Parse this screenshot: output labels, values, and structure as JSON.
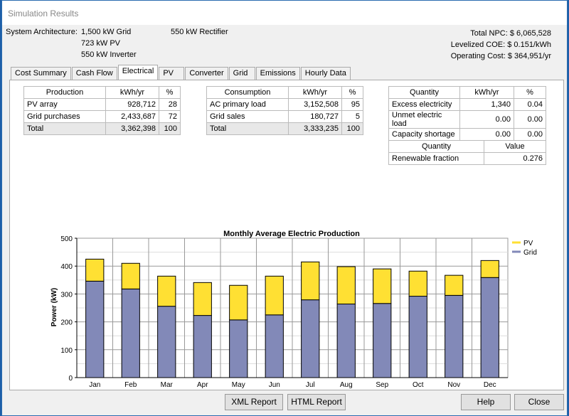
{
  "window": {
    "title": "Simulation Results"
  },
  "architecture": {
    "label": "System Architecture:",
    "items": [
      "1,500 kW Grid",
      "723 kW PV",
      "550 kW Inverter",
      "550 kW Rectifier"
    ]
  },
  "costs": [
    {
      "label": "Total NPC:",
      "value": "$ 6,065,528"
    },
    {
      "label": "Levelized COE:",
      "value": "$ 0.151/kWh"
    },
    {
      "label": "Operating Cost:",
      "value": "$ 364,951/yr"
    }
  ],
  "tabs": [
    "Cost Summary",
    "Cash Flow",
    "Electrical",
    "PV",
    "Converter",
    "Grid",
    "Emissions",
    "Hourly Data"
  ],
  "active_tab": "Electrical",
  "production": {
    "headers": [
      "Production",
      "kWh/yr",
      "%"
    ],
    "rows": [
      [
        "PV array",
        "928,712",
        "28"
      ],
      [
        "Grid purchases",
        "2,433,687",
        "72"
      ],
      [
        "Total",
        "3,362,398",
        "100"
      ]
    ]
  },
  "consumption": {
    "headers": [
      "Consumption",
      "kWh/yr",
      "%"
    ],
    "rows": [
      [
        "AC primary load",
        "3,152,508",
        "95"
      ],
      [
        "Grid sales",
        "180,727",
        "5"
      ],
      [
        "Total",
        "3,333,235",
        "100"
      ]
    ]
  },
  "quantity": {
    "headers": [
      "Quantity",
      "kWh/yr",
      "%"
    ],
    "rows": [
      [
        "Excess electricity",
        "1,340",
        "0.04"
      ],
      [
        "Unmet electric load",
        "0.00",
        "0.00"
      ],
      [
        "Capacity shortage",
        "0.00",
        "0.00"
      ]
    ]
  },
  "renewable": {
    "headers": [
      "Quantity",
      "Value"
    ],
    "rows": [
      [
        "Renewable fraction",
        "0.276"
      ]
    ]
  },
  "chart_data": {
    "type": "bar",
    "stacked": true,
    "title": "Monthly Average Electric Production",
    "xlabel": "",
    "ylabel": "Power (kW)",
    "ylim": [
      0,
      500
    ],
    "yticks": [
      0,
      100,
      200,
      300,
      400,
      500
    ],
    "grid": true,
    "legend": "top-right",
    "categories": [
      "Jan",
      "Feb",
      "Mar",
      "Apr",
      "May",
      "Jun",
      "Jul",
      "Aug",
      "Sep",
      "Oct",
      "Nov",
      "Dec"
    ],
    "series": [
      {
        "name": "Grid",
        "color": "#8289b8",
        "values": [
          346,
          318,
          256,
          223,
          207,
          225,
          279,
          264,
          266,
          292,
          295,
          359
        ]
      },
      {
        "name": "PV",
        "color": "#ffe033",
        "values": [
          79,
          92,
          108,
          118,
          124,
          139,
          136,
          134,
          124,
          90,
          72,
          61
        ]
      }
    ]
  },
  "buttons": {
    "xml": "XML Report",
    "html": "HTML Report",
    "help": "Help",
    "close": "Close"
  }
}
